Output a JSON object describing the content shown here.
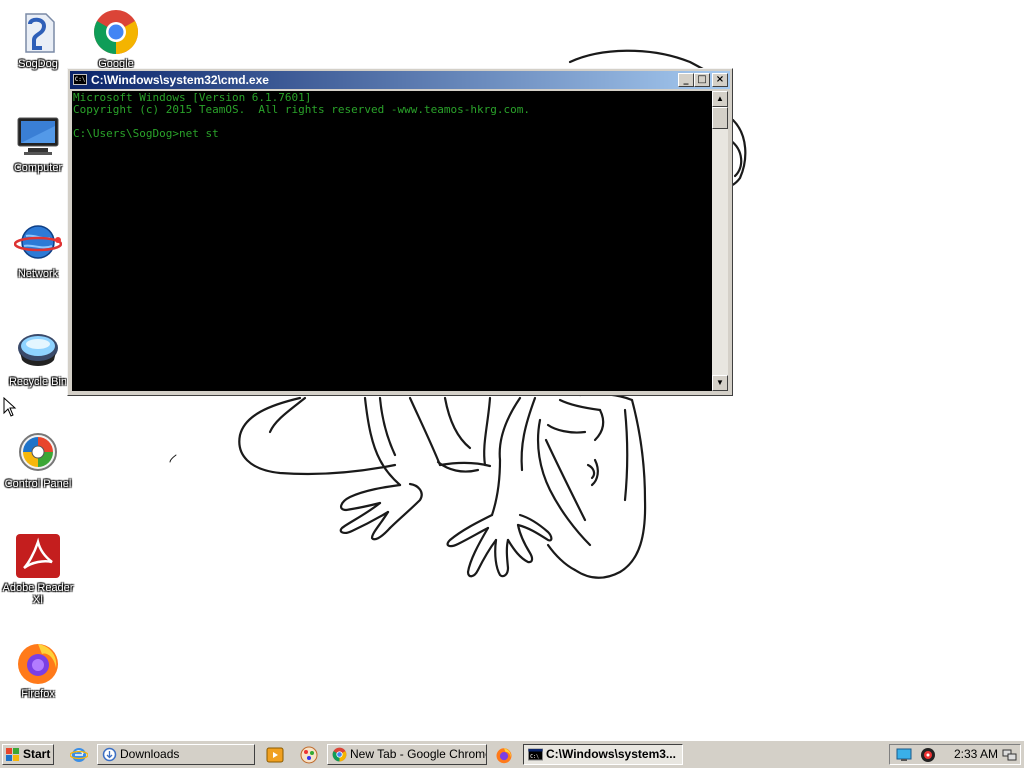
{
  "desktop": {
    "icons": [
      {
        "name": "SogDog"
      },
      {
        "name": "Google Chrome"
      },
      {
        "name": "Computer"
      },
      {
        "name": "Network"
      },
      {
        "name": "Recycle Bin"
      },
      {
        "name": "Control Panel"
      },
      {
        "name": "Adobe Reader XI"
      },
      {
        "name": "Firefox"
      }
    ]
  },
  "cmd_window": {
    "title": "C:\\Windows\\system32\\cmd.exe",
    "buttons": {
      "minimize": "_",
      "maximize": "□",
      "close": "×"
    },
    "lines": [
      "Microsoft Windows [Version 6.1.7601]",
      "Copyright (c) 2015 TeamOS.  All rights reserved -www.teamos-hkrg.com.",
      "",
      "C:\\Users\\SogDog>net st"
    ]
  },
  "taskbar": {
    "start_label": "Start",
    "buttons": [
      {
        "label": "Downloads",
        "icon": "folder-icon",
        "active": false
      },
      {
        "label": "New Tab - Google Chrome",
        "icon": "chrome-icon",
        "active": false
      },
      {
        "label": "C:\\Windows\\system3...",
        "icon": "cmd-icon",
        "active": true
      }
    ],
    "clock": "2:33 AM"
  },
  "colors": {
    "console_text": "#2aa22a",
    "titlebar_start": "#0a246a",
    "titlebar_end": "#a6caf0",
    "taskbar": "#d4d0c8"
  }
}
